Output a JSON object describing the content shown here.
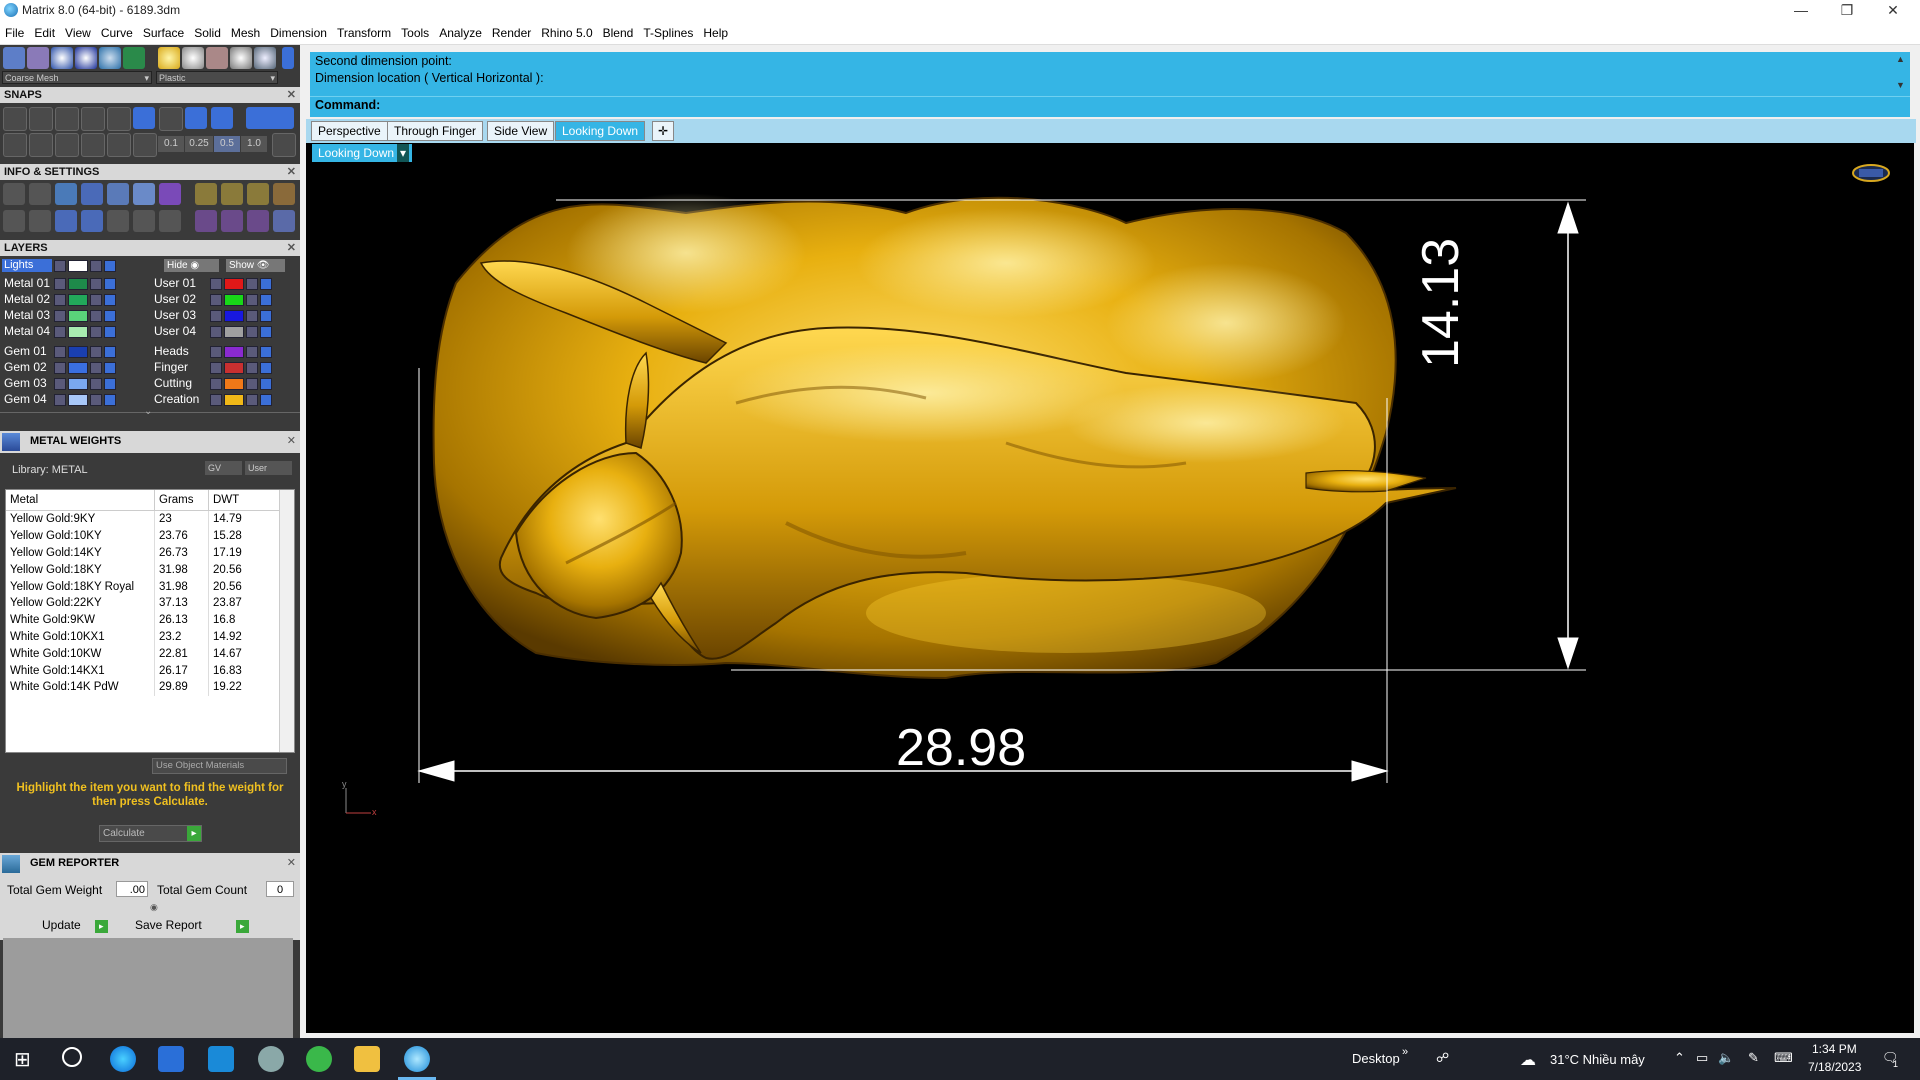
{
  "window": {
    "title": "Matrix 8.0 (64-bit) - 6189.3dm",
    "minimize": "—",
    "restore": "❐",
    "close": "✕"
  },
  "menu": [
    "File",
    "Edit",
    "View",
    "Curve",
    "Surface",
    "Solid",
    "Mesh",
    "Dimension",
    "Transform",
    "Tools",
    "Analyze",
    "Render",
    "Rhino 5.0",
    "Blend",
    "T-Splines",
    "Help"
  ],
  "render_settings": {
    "mesh": "Coarse Mesh",
    "material": "Plastic"
  },
  "snaps": {
    "title": "SNAPS",
    "values": [
      "0.1",
      "0.25",
      "0.5",
      "1.0"
    ]
  },
  "info_settings": {
    "title": "INFO & SETTINGS"
  },
  "layers": {
    "title": "LAYERS",
    "lights_label": "Lights",
    "hide_label": "Hide",
    "show_label": "Show",
    "left": [
      {
        "name": "Metal 01",
        "color": "#1e8a4a"
      },
      {
        "name": "Metal 02",
        "color": "#22a85a"
      },
      {
        "name": "Metal 03",
        "color": "#5ad27a"
      },
      {
        "name": "Metal 04",
        "color": "#a8ecb0"
      },
      {
        "name": "Gem 01",
        "color": "#1a3fb0"
      },
      {
        "name": "Gem 02",
        "color": "#3a6fe0"
      },
      {
        "name": "Gem 03",
        "color": "#7aa8f0"
      },
      {
        "name": "Gem 04",
        "color": "#a8c8f8"
      }
    ],
    "right": [
      {
        "name": "User 01",
        "color": "#e01818"
      },
      {
        "name": "User 02",
        "color": "#18d818"
      },
      {
        "name": "User 03",
        "color": "#1818e0"
      },
      {
        "name": "User 04",
        "color": "#a0a0a0"
      },
      {
        "name": "Heads",
        "color": "#8a2ad0"
      },
      {
        "name": "Finger",
        "color": "#c83030"
      },
      {
        "name": "Cutting",
        "color": "#f07818"
      },
      {
        "name": "Creation",
        "color": "#f0b818"
      }
    ]
  },
  "metal_weights": {
    "title": "METAL WEIGHTS",
    "library": "Library: METAL",
    "gv_label": "GV",
    "user_label": "User",
    "columns": [
      "Metal",
      "Grams",
      "DWT"
    ],
    "rows": [
      [
        "Yellow Gold:9KY",
        "23",
        "14.79"
      ],
      [
        "Yellow Gold:10KY",
        "23.76",
        "15.28"
      ],
      [
        "Yellow Gold:14KY",
        "26.73",
        "17.19"
      ],
      [
        "Yellow Gold:18KY",
        "31.98",
        "20.56"
      ],
      [
        "Yellow Gold:18KY Royal",
        "31.98",
        "20.56"
      ],
      [
        "Yellow Gold:22KY",
        "37.13",
        "23.87"
      ],
      [
        "White Gold:9KW",
        "26.13",
        "16.8"
      ],
      [
        "White Gold:10KX1",
        "23.2",
        "14.92"
      ],
      [
        "White Gold:10KW",
        "22.81",
        "14.67"
      ],
      [
        "White Gold:14KX1",
        "26.17",
        "16.83"
      ],
      [
        "White Gold:14K PdW",
        "29.89",
        "19.22"
      ]
    ],
    "use_object_materials": "Use Object Materials",
    "hint": "Highlight the item you want to find the weight for then press Calculate.",
    "calculate": "Calculate"
  },
  "gem_reporter": {
    "title": "GEM REPORTER",
    "total_weight_label": "Total Gem Weight",
    "total_weight_value": ".00",
    "total_count_label": "Total Gem Count",
    "total_count_value": "0",
    "update": "Update",
    "save_report": "Save Report"
  },
  "command": {
    "line1": "Second dimension point:",
    "line2": "Dimension location ( Vertical  Horizontal ):",
    "label": "Command:"
  },
  "view_tabs": [
    "Perspective",
    "Through Finger",
    "Side View",
    "Looking Down"
  ],
  "active_tab": "Looking Down",
  "viewport": {
    "name": "Looking Down",
    "width_dim": "28.98",
    "height_dim": "14.13",
    "axis_y": "y",
    "axis_x": "x"
  },
  "taskbar": {
    "desktop": "Desktop",
    "weather": "31°C  Nhiều mây",
    "time": "1:34 PM",
    "date": "7/18/2023",
    "notification_count": "1"
  }
}
